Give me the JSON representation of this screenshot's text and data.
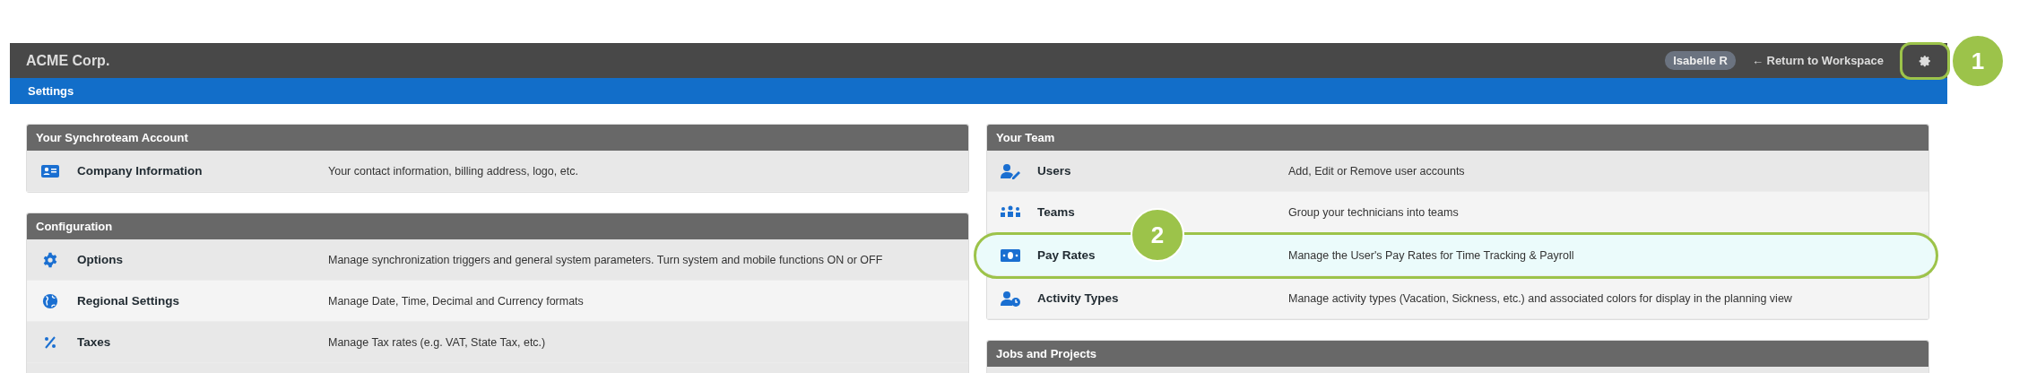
{
  "header": {
    "company": "ACME Corp.",
    "user": "Isabelle R",
    "return_link": "← Return to Workspace"
  },
  "breadcrumb": "Settings",
  "columns": [
    [
      {
        "title": "Your Synchroteam Account",
        "rows": [
          {
            "kind": "id-card",
            "label": "Company Information",
            "description": "Your contact information, billing address, logo, etc.",
            "highlighted": false
          }
        ]
      },
      {
        "title": "Configuration",
        "rows": [
          {
            "kind": "gear",
            "label": "Options",
            "description": "Manage synchronization triggers and general system parameters. Turn system and mobile functions ON or OFF",
            "highlighted": false
          },
          {
            "kind": "globe",
            "label": "Regional Settings",
            "description": "Manage Date, Time, Decimal and Currency formats",
            "highlighted": false
          },
          {
            "kind": "percent",
            "label": "Taxes",
            "description": "Manage Tax rates (e.g. VAT, State Tax, etc.)",
            "highlighted": false
          }
        ]
      }
    ],
    [
      {
        "title": "Your Team",
        "rows": [
          {
            "kind": "user-edit",
            "label": "Users",
            "description": "Add, Edit or Remove user accounts",
            "highlighted": false
          },
          {
            "kind": "people",
            "label": "Teams",
            "description": "Group your technicians into teams",
            "highlighted": false
          },
          {
            "kind": "money",
            "label": "Pay Rates",
            "description": "Manage the User's Pay Rates for Time Tracking & Payroll",
            "highlighted": true
          },
          {
            "kind": "user-clock",
            "label": "Activity Types",
            "description": "Manage activity types (Vacation, Sickness, etc.) and associated colors for display in the planning view",
            "highlighted": false
          }
        ]
      },
      {
        "title": "Jobs and Projects"
      }
    ]
  ],
  "callouts": [
    {
      "number": "1"
    },
    {
      "number": "2"
    }
  ]
}
